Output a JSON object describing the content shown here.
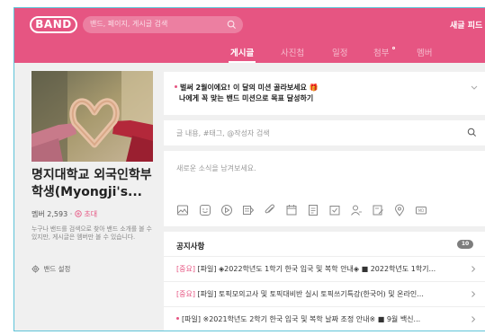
{
  "header": {
    "logo": "BAND",
    "search_placeholder": "밴드, 페이지, 게시글 검색",
    "new_band": "새글 피드"
  },
  "tabs": [
    {
      "label": "게시글",
      "active": true
    },
    {
      "label": "사진첩",
      "active": false
    },
    {
      "label": "일정",
      "active": false
    },
    {
      "label": "첨부",
      "active": false,
      "new_dot": true
    },
    {
      "label": "멤버",
      "active": false
    }
  ],
  "band": {
    "name": "명지대학교 외국인학부학생(Myongji's...",
    "members_label": "멤버 2,593",
    "invite_label": "초대",
    "description": "누구나 밴드를 검색으로 찾아 밴드 소개를 볼 수 있지만, 게시글은 멤버만 볼 수 있습니다.",
    "settings_label": "밴드 설정"
  },
  "mission": {
    "line1": "벌써 2월이에요! 이 달의 미션 골라보세요 🎁",
    "line2": "나에게 꼭 맞는 밴드 미션으로 목표 달성하기"
  },
  "post_search": {
    "placeholder": "글 내용, #태그, @작성자 검색"
  },
  "compose": {
    "placeholder": "새로운 소식을 남겨보세요."
  },
  "notices": {
    "title": "공지사항",
    "count": "10",
    "items": [
      {
        "tag": "[중요]",
        "text": " [파일] ◈2022학년도 1학기 한국 입국 및 복학 안내◈ ■ 2022학년도 1학기..."
      },
      {
        "tag": "[중요]",
        "text": " [파일] 토픽모의고사 및 토픽대비반 실시 토픽쓰기특강(한국어) 및 온라인..."
      },
      {
        "tag": "",
        "text": "[파일] ※2021학년도 2학기 한국 입국 및 복학 날짜 조정 안내※ ■ 9월 백신..."
      }
    ]
  },
  "colors": {
    "brand": "#e65582",
    "background": "#f0f0f0"
  }
}
